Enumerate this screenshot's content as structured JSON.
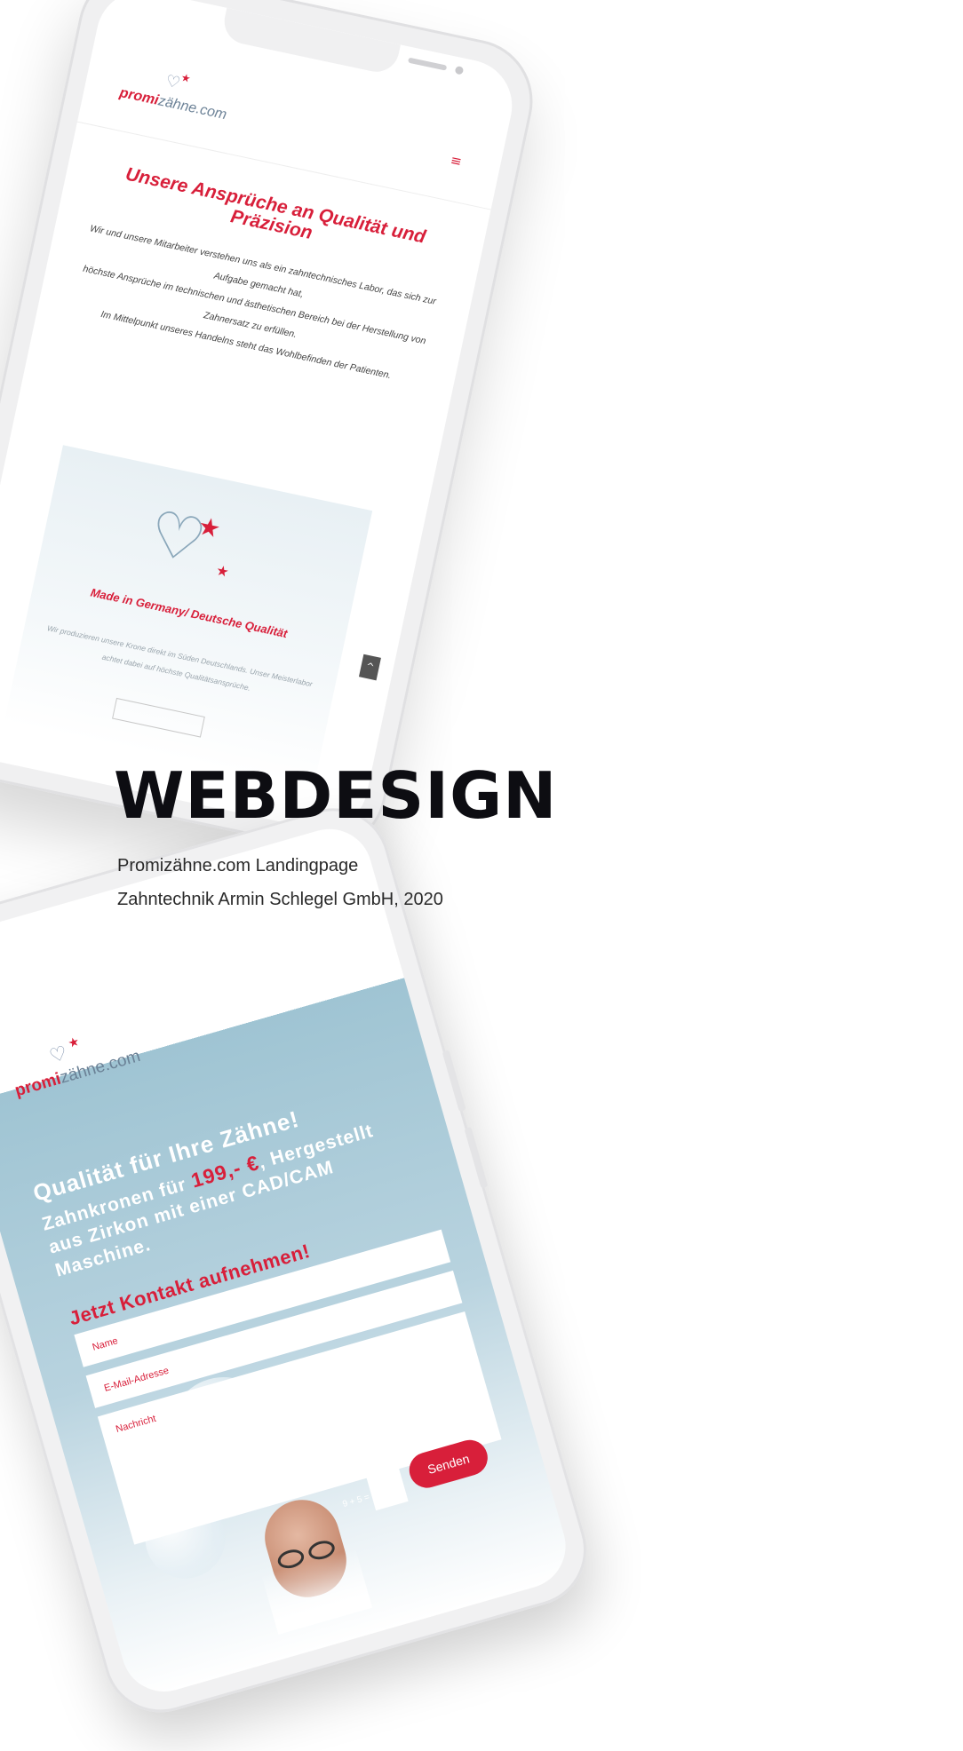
{
  "colors": {
    "brand_red": "#d81f3a",
    "brand_grey": "#6b8196",
    "heading": "#0d0d12",
    "hero_blue": "#9fc4d3"
  },
  "phone_front": {
    "logo": {
      "brand_red": "promi",
      "brand_grey": "zähne.com",
      "icon": "tooth-star-icon"
    },
    "hero": {
      "headline": "Qualität für Ihre Zähne!",
      "line_prefix": "Zahnkronen für ",
      "price": "199,- €",
      "line_suffix": ", Hergestellt aus Zirkon mit einer CAD/CAM Maschine.",
      "cta": "Jetzt Kontakt aufnehmen!"
    },
    "form": {
      "name_placeholder": "Name",
      "email_placeholder": "E-Mail-Adresse",
      "message_placeholder": "Nachricht",
      "captcha_label": "9 + 5 =",
      "send_label": "Senden"
    }
  },
  "phone_back": {
    "logo": {
      "brand_red": "promi",
      "brand_grey": "zähne.com",
      "icon": "tooth-star-icon"
    },
    "menu_icon": "≡",
    "title": "Unsere Ansprüche an Qualität und Präzision",
    "paragraphs": [
      "Wir und unsere Mitarbeiter verstehen uns als ein zahntechnisches Labor, das sich zur Aufgabe gemacht hat,",
      "höchste Ansprüche im technischen und ästhetischen Bereich bei der Herstellung von Zahnersatz zu erfüllen.",
      "Im Mittelpunkt unseres Handelns steht das Wohlbefinden der Patienten."
    ],
    "card": {
      "title": "Made in Germany/ Deutsche Qualität",
      "text": "Wir produzieren unsere Krone direkt im Süden Deutschlands. Unser Meisterlabor achtet dabei auf höchste Qualitätsansprüche."
    },
    "scroll_top_icon": "^"
  },
  "heading": "WEBDESIGN",
  "subtitle_1": "Promizähne.com Landingpage",
  "subtitle_2": "Zahntechnik Armin Schlegel GmbH, 2020"
}
